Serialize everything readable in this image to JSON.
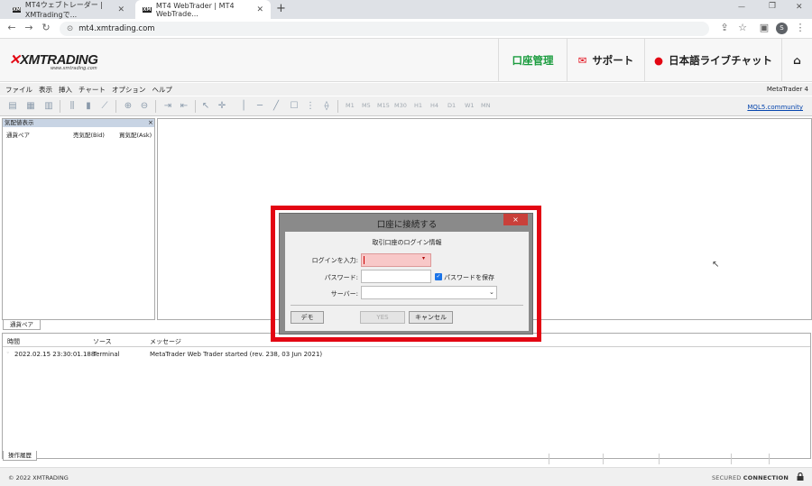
{
  "browser": {
    "tabs": [
      {
        "title": "MT4ウェブトレーダー | XMTradingで..."
      },
      {
        "title": "MT4 WebTrader | MT4 WebTrade..."
      }
    ],
    "new_tab": "+",
    "url": "mt4.xmtrading.com",
    "window_controls": {
      "minimize": "—",
      "maximize": "❐",
      "close": "✕"
    },
    "profile_initial": "S"
  },
  "site": {
    "logo_text": "XMTRADING",
    "logo_subtext": "www.xmtrading.com",
    "nav": {
      "account": "口座管理",
      "support": "サポート",
      "chat": "日本語ライブチャット"
    },
    "colors": {
      "accent_green": "#1a9c3e",
      "brand_red": "#e30613"
    }
  },
  "menu": [
    "ファイル",
    "表示",
    "挿入",
    "チャート",
    "オプション",
    "ヘルプ"
  ],
  "platform_label": "MetaTrader 4",
  "toolbar": {
    "timeframes": [
      "M1",
      "M5",
      "M15",
      "M30",
      "H1",
      "H4",
      "D1",
      "W1",
      "MN"
    ],
    "mql5_link": "MQL5.community"
  },
  "market_watch": {
    "title": "気配値表示",
    "close": "×",
    "columns": [
      "通貨ペア",
      "売気配(Bid)",
      "買気配(Ask)"
    ],
    "tab": "通貨ペア"
  },
  "terminal": {
    "columns": [
      "時間",
      "ソース",
      "メッセージ"
    ],
    "rows": [
      {
        "time": "2022.02.15 23:30:01.188",
        "source": "Terminal",
        "message": "MetaTrader Web Trader started (rev. 238, 03 Jun 2021)"
      }
    ],
    "tab": "操作履歴"
  },
  "footer": {
    "copyright": "© 2022 XMTRADING",
    "secured": "SECURED",
    "connection": "CONNECTION"
  },
  "dialog": {
    "title": "口座に接続する",
    "close": "×",
    "subtitle": "取引口座のログイン情報",
    "login_label": "ログインを入力:",
    "password_label": "パスワード:",
    "save_password_label": "パスワードを保存",
    "save_password_checked": true,
    "server_label": "サーバー:",
    "demo_button": "デモ",
    "ok_button": "YES",
    "cancel_button": "キャンセル"
  }
}
